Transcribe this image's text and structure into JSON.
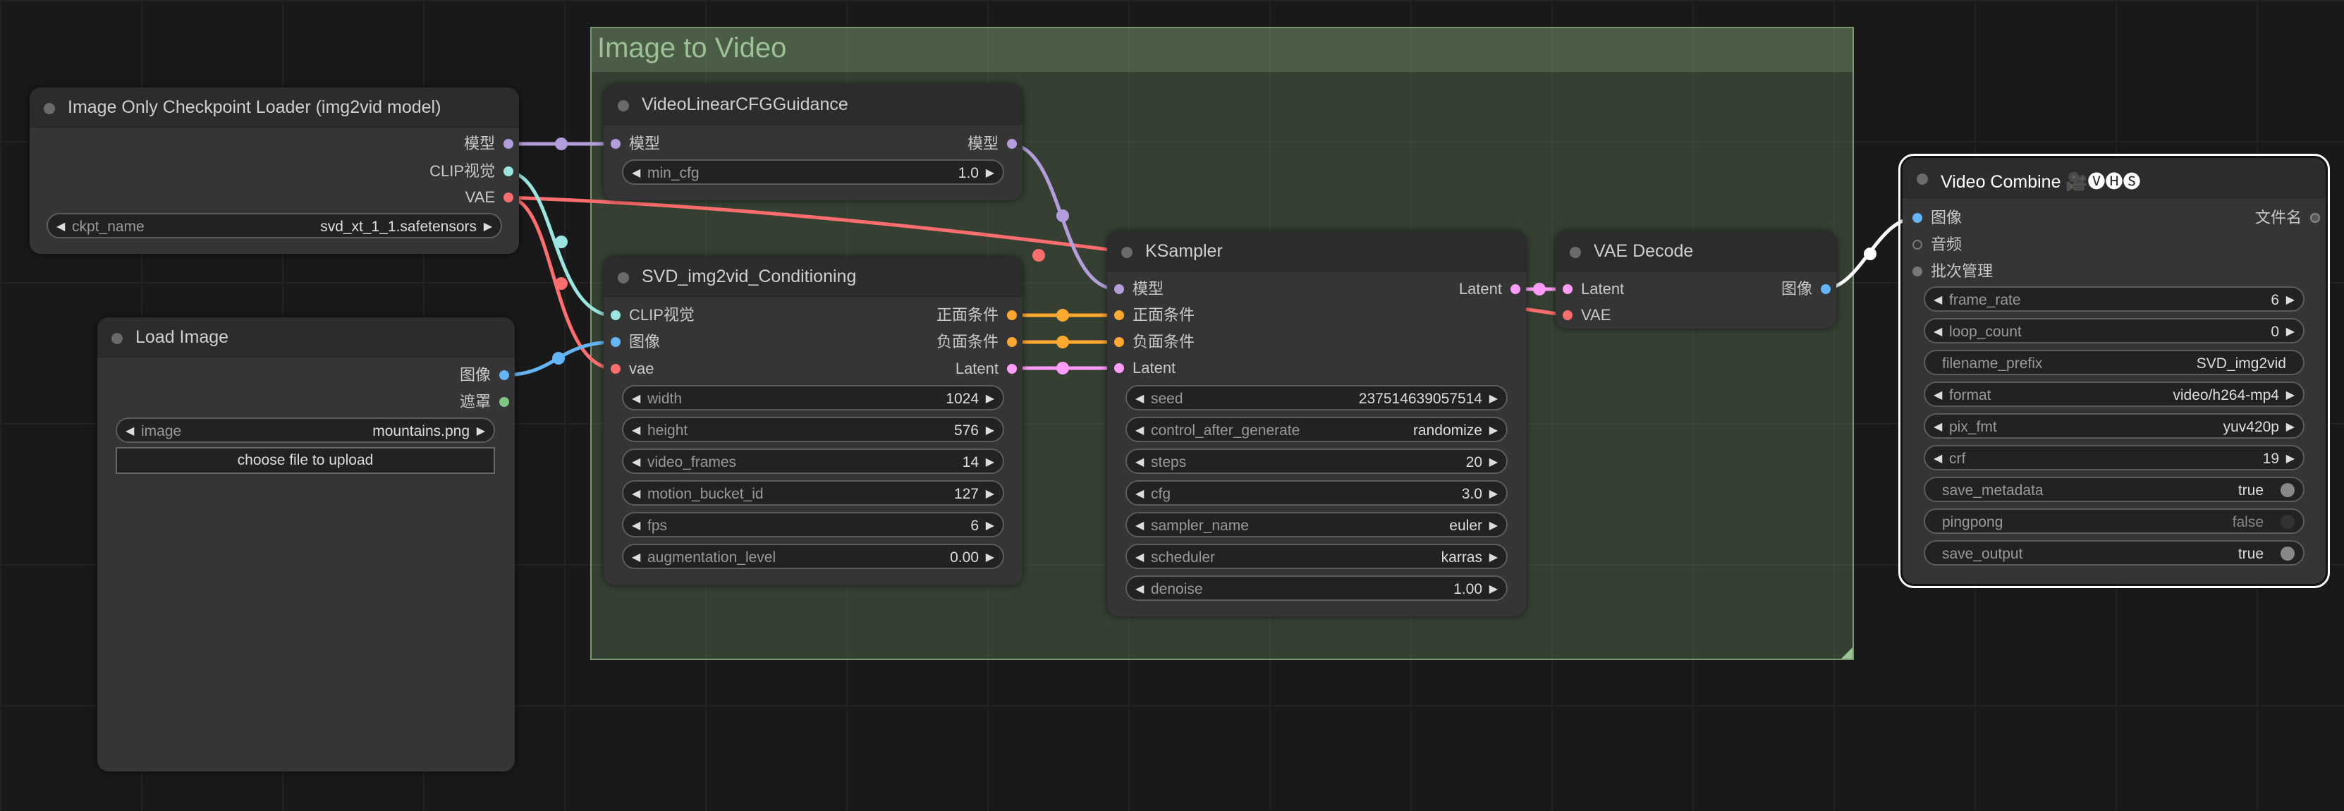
{
  "colors": {
    "clip": "#9be5e0",
    "model": "#b39ddb",
    "vae": "#ff6e6e",
    "image": "#64b5f6",
    "mask": "#81c784",
    "conditioning": "#ffa931",
    "latent": "#ff9cf9"
  },
  "group": {
    "title": "Image to Video"
  },
  "checkpoint_loader": {
    "title": "Image Only Checkpoint Loader (img2vid model)",
    "outputs": [
      "模型",
      "CLIP视觉",
      "VAE"
    ],
    "ckpt_label": "ckpt_name",
    "ckpt_value": "svd_xt_1_1.safetensors"
  },
  "load_image": {
    "title": "Load Image",
    "outputs": [
      "图像",
      "遮罩"
    ],
    "image_label": "image",
    "image_value": "mountains.png",
    "upload_button": "choose file to upload"
  },
  "cfg_guidance": {
    "title": "VideoLinearCFGGuidance",
    "input": "模型",
    "output": "模型",
    "min_cfg_label": "min_cfg",
    "min_cfg_value": "1.0"
  },
  "conditioning": {
    "title": "SVD_img2vid_Conditioning",
    "inputs": [
      "CLIP视觉",
      "图像",
      "vae"
    ],
    "outputs": [
      "正面条件",
      "负面条件",
      "Latent"
    ],
    "widgets": [
      {
        "label": "width",
        "value": "1024"
      },
      {
        "label": "height",
        "value": "576"
      },
      {
        "label": "video_frames",
        "value": "14"
      },
      {
        "label": "motion_bucket_id",
        "value": "127"
      },
      {
        "label": "fps",
        "value": "6"
      },
      {
        "label": "augmentation_level",
        "value": "0.00"
      }
    ]
  },
  "ksampler": {
    "title": "KSampler",
    "inputs": [
      "模型",
      "正面条件",
      "负面条件",
      "Latent"
    ],
    "output": "Latent",
    "widgets": [
      {
        "label": "seed",
        "value": "237514639057514"
      },
      {
        "label": "control_after_generate",
        "value": "randomize"
      },
      {
        "label": "steps",
        "value": "20"
      },
      {
        "label": "cfg",
        "value": "3.0"
      },
      {
        "label": "sampler_name",
        "value": "euler"
      },
      {
        "label": "scheduler",
        "value": "karras"
      },
      {
        "label": "denoise",
        "value": "1.00"
      }
    ]
  },
  "vae_decode": {
    "title": "VAE Decode",
    "inputs": [
      "Latent",
      "VAE"
    ],
    "output": "图像"
  },
  "video_combine": {
    "title": "Video Combine 🎥🅥🅗🅢",
    "inputs": [
      "图像",
      "音频",
      "批次管理"
    ],
    "output": "文件名",
    "widgets": [
      {
        "label": "frame_rate",
        "value": "6"
      },
      {
        "label": "loop_count",
        "value": "0"
      },
      {
        "label": "filename_prefix",
        "value": "SVD_img2vid"
      },
      {
        "label": "format",
        "value": "video/h264-mp4"
      },
      {
        "label": "pix_fmt",
        "value": "yuv420p"
      },
      {
        "label": "crf",
        "value": "19"
      },
      {
        "label": "save_metadata",
        "value": "true"
      },
      {
        "label": "pingpong",
        "value": "false"
      },
      {
        "label": "save_output",
        "value": "true"
      }
    ]
  }
}
